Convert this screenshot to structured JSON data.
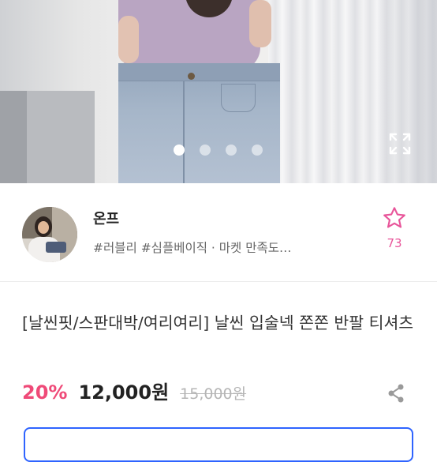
{
  "gallery": {
    "total_images": 4,
    "active_index": 0,
    "image_alt": "product photo: lilac top with light wash jeans",
    "expand_icon": "expand-icon"
  },
  "seller": {
    "name": "온프",
    "tags": "#러블리 #심플베이직 · 마켓 만족도…",
    "favorite_icon": "star-outline-icon",
    "favorite_count": "73"
  },
  "product": {
    "title": "[날씬핏/스판대박/여리여리] 날씬 입술넥 쫀쫀 반팔 티셔츠",
    "discount": "20%",
    "price": "12,000원",
    "original_price": "15,000원",
    "share_icon": "share-icon"
  },
  "colors": {
    "accent_pink": "#ef4a78",
    "favorite_pink": "#e8559a",
    "cta_border_blue": "#2f64ff"
  }
}
